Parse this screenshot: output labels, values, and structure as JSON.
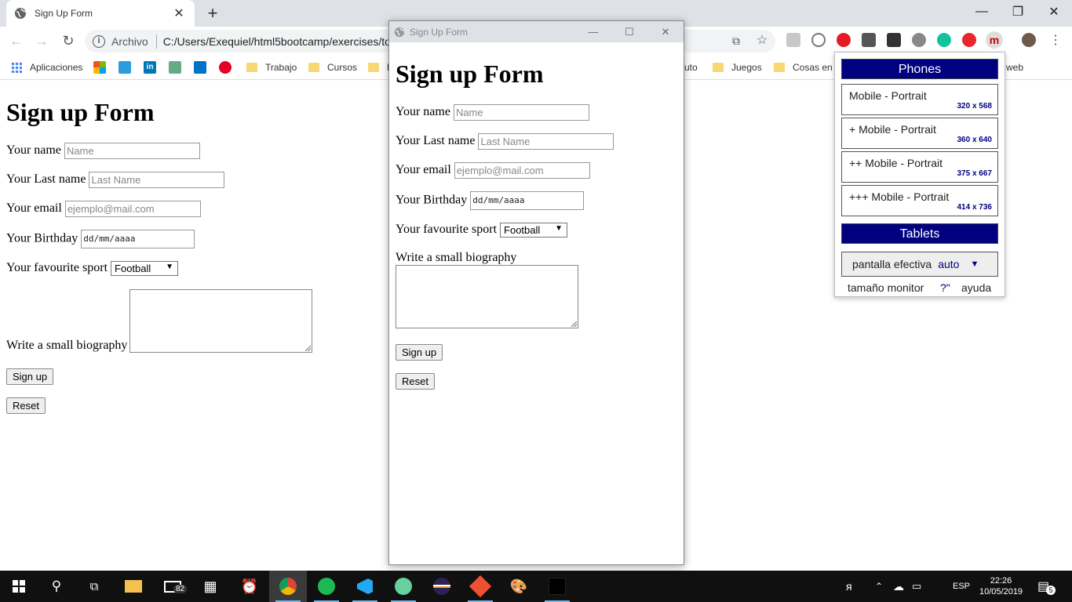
{
  "browser": {
    "tab_title": "Sign Up Form",
    "tab_close": "✕",
    "new_tab": "+",
    "url_scheme": "Archivo",
    "url_path": "C:/Users/Exequiel/html5bootcamp/exercises/to",
    "window_minimize": "—",
    "window_restore": "❐",
    "window_close": "✕"
  },
  "bookmarks": {
    "apps": "Aplicaciones",
    "folders": [
      "Trabajo",
      "Cursos",
      "F",
      "uto",
      "Juegos",
      "Cosas en g",
      "web"
    ]
  },
  "form": {
    "title": "Sign up Form",
    "name_label": "Your name",
    "name_placeholder": "Name",
    "lastname_label": "Your Last name",
    "lastname_placeholder": "Last Name",
    "email_label": "Your email",
    "email_placeholder": "ejemplo@mail.com",
    "birthday_label": "Your Birthday",
    "birthday_value": "dd/mm/aaaa",
    "sport_label": "Your favourite sport",
    "sport_value": "Football",
    "bio_label": "Write a small biography",
    "signup_button": "Sign up",
    "reset_button": "Reset"
  },
  "popup": {
    "window_title": "Sign Up Form",
    "min": "—",
    "max": "☐",
    "close": "✕"
  },
  "extension": {
    "phones_header": "Phones",
    "devices": [
      {
        "name": "Mobile - Portrait",
        "res": "320 x 568"
      },
      {
        "name": "+ Mobile - Portrait",
        "res": "360 x 640"
      },
      {
        "name": "++ Mobile - Portrait",
        "res": "375 x 667"
      },
      {
        "name": "+++ Mobile - Portrait",
        "res": "414 x 736"
      }
    ],
    "tablets_header": "Tablets",
    "pantalla_label": "pantalla efectiva",
    "pantalla_value": "auto",
    "pantalla_arrow": "▼",
    "monitor_label": "tamaño monitor",
    "monitor_value": "?\"",
    "help_label": "ayuda"
  },
  "taskbar": {
    "mail_badge": "82",
    "language": "ESP",
    "time": "22:26",
    "date": "10/05/2019",
    "notifications": "5"
  },
  "colors": {
    "ext_header": "#000080",
    "taskbar": "#101010",
    "accent": "#76b9ed"
  }
}
